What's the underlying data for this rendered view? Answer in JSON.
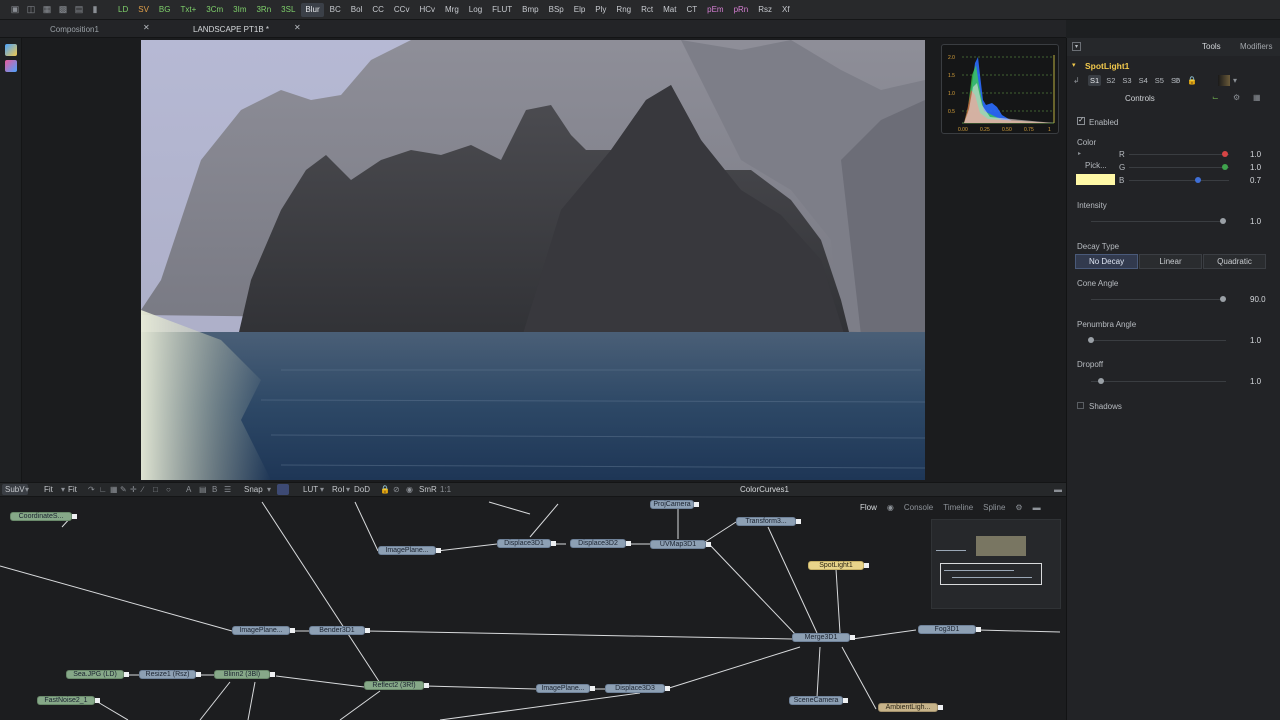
{
  "toolbar": {
    "buttons": [
      "LD",
      "SV",
      "BG",
      "Txt+",
      "3Cm",
      "3Im",
      "3Rn",
      "3SL",
      "Blur",
      "BC",
      "Bol",
      "CC",
      "CCv",
      "HCv",
      "Mrg",
      "Log",
      "FLUT",
      "Bmp",
      "BSp",
      "Elp",
      "Ply",
      "Rng",
      "Rct",
      "Mat",
      "CT",
      "pEm",
      "pRn",
      "Rsz",
      "Xf"
    ],
    "active": "Blur"
  },
  "tabs": [
    {
      "label": "Composition1"
    },
    {
      "label": "LANDSCAPE PT1B *"
    }
  ],
  "inspector": {
    "tabs": [
      "Tools",
      "Modifiers"
    ],
    "tool_name": "SpotLight1",
    "shortcuts": [
      "S1",
      "S2",
      "S3",
      "S4",
      "S5",
      "S6"
    ],
    "section": "Controls",
    "enabled_label": "Enabled",
    "color_label": "Color",
    "pick_label": "Pick...",
    "channels": [
      {
        "name": "R",
        "value": "1.0"
      },
      {
        "name": "G",
        "value": "1.0"
      },
      {
        "name": "B",
        "value": "0.7"
      }
    ],
    "swatch_color": "#fff8a6",
    "intensity_label": "Intensity",
    "intensity_value": "1.0",
    "decay_label": "Decay Type",
    "decay_options": [
      "No Decay",
      "Linear",
      "Quadratic"
    ],
    "decay_selected": "No Decay",
    "cone_label": "Cone Angle",
    "cone_value": "90.0",
    "penumbra_label": "Penumbra Angle",
    "penumbra_value": "1.0",
    "dropoff_label": "Dropoff",
    "dropoff_value": "1.0",
    "shadows_label": "Shadows"
  },
  "histogram": {
    "y_ticks": [
      "2.0",
      "1.5",
      "1.0",
      "0.5"
    ],
    "x_ticks": [
      "0.00",
      "0.25",
      "0.50",
      "0.75",
      "1"
    ]
  },
  "nodebar": {
    "subview": "SubV",
    "fit1": "Fit",
    "fit2": "Fit",
    "snap": "Snap",
    "lut": "LUT",
    "roi": "RoI",
    "dod": "DoD",
    "smr": "SmR",
    "ratio": "1:1",
    "title": "ColorCurves1"
  },
  "flow": {
    "tabs": [
      "Flow",
      "Console",
      "Timeline",
      "Spline"
    ],
    "nodes": {
      "coord": "CoordinateS...",
      "proj_camera": "ProjCamera",
      "transform": "Transform3...",
      "imageplane1": "ImagePlane...",
      "displace1": "Displace3D1",
      "displace2": "Displace3D2",
      "uvmap": "UVMap3D1",
      "spotlight": "SpotLight1",
      "imageplane2": "ImagePlane...",
      "bender": "Bender3D1",
      "merge": "Merge3D1",
      "fog": "Fog3D1",
      "sea": "Sea.JPG (LD)",
      "resize": "Resize1 (Rsz)",
      "blinn": "Blinn2 (3Bl)",
      "reflect": "Reflect2 (3Rf)",
      "imageplane3": "ImagePlane...",
      "displace3": "Displace3D3",
      "noise": "FastNoise2_1",
      "scenecam": "SceneCamera",
      "ambient": "AmbientLigh..."
    }
  }
}
